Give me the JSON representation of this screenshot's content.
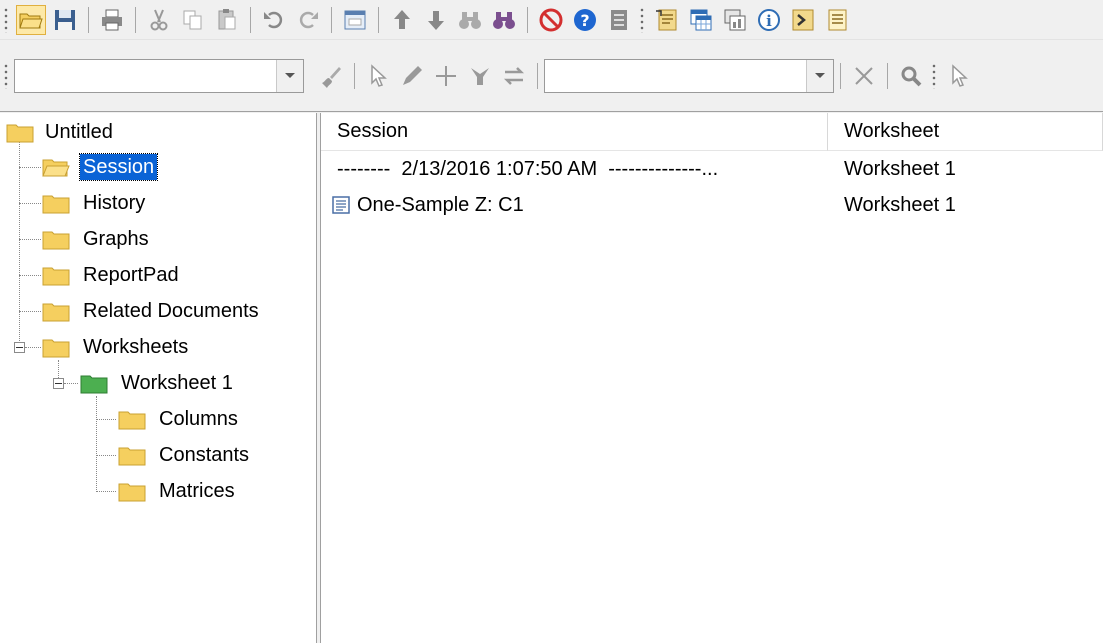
{
  "tree": {
    "root_label": "Untitled",
    "items": [
      {
        "label": "Session"
      },
      {
        "label": "History"
      },
      {
        "label": "Graphs"
      },
      {
        "label": "ReportPad"
      },
      {
        "label": "Related Documents"
      },
      {
        "label": "Worksheets"
      }
    ],
    "worksheet": {
      "label": "Worksheet 1"
    },
    "worksheet_children": [
      {
        "label": "Columns"
      },
      {
        "label": "Constants"
      },
      {
        "label": "Matrices"
      }
    ],
    "selected": "Session"
  },
  "list": {
    "columns": [
      "Session",
      "Worksheet"
    ],
    "rows": [
      {
        "session": "--------  2/13/2016 1:07:50 AM  --------------...",
        "worksheet": "Worksheet 1"
      },
      {
        "session": "One-Sample Z: C1",
        "worksheet": "Worksheet 1",
        "icon": "document-icon"
      }
    ]
  },
  "toolbar": {
    "combo_left_value": "",
    "combo_right_value": ""
  },
  "colors": {
    "folder": "#f5cf5f",
    "folder_green": "#4caf50",
    "selection": "#0a63d6",
    "cancel_red": "#d32f2f",
    "help_blue": "#1e66d0"
  }
}
